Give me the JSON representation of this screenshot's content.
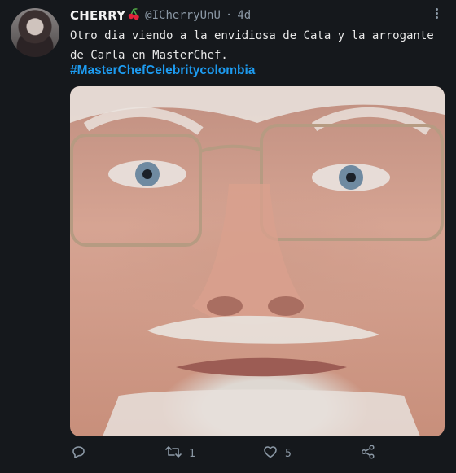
{
  "tweet": {
    "display_name": "CHERRY",
    "handle": "@ICherryUnU",
    "separator": "·",
    "time": "4d",
    "text": "Otro dia viendo a la envidiosa de Cata y la arrogante de Carla en MasterChef.",
    "hashtag": "#MasterChefCelebritycolombia",
    "name_emoji": "cherries-icon",
    "more_icon": "more-vertical-icon"
  },
  "actions": {
    "reply": {
      "icon": "reply-icon",
      "count": ""
    },
    "retweet": {
      "icon": "retweet-icon",
      "count": "1"
    },
    "like": {
      "icon": "heart-icon",
      "count": "5"
    },
    "share": {
      "icon": "share-icon"
    }
  },
  "colors": {
    "background": "#15181c",
    "accent": "#1d9bf0",
    "muted": "#8b98a5",
    "text": "#e8e8e8"
  }
}
